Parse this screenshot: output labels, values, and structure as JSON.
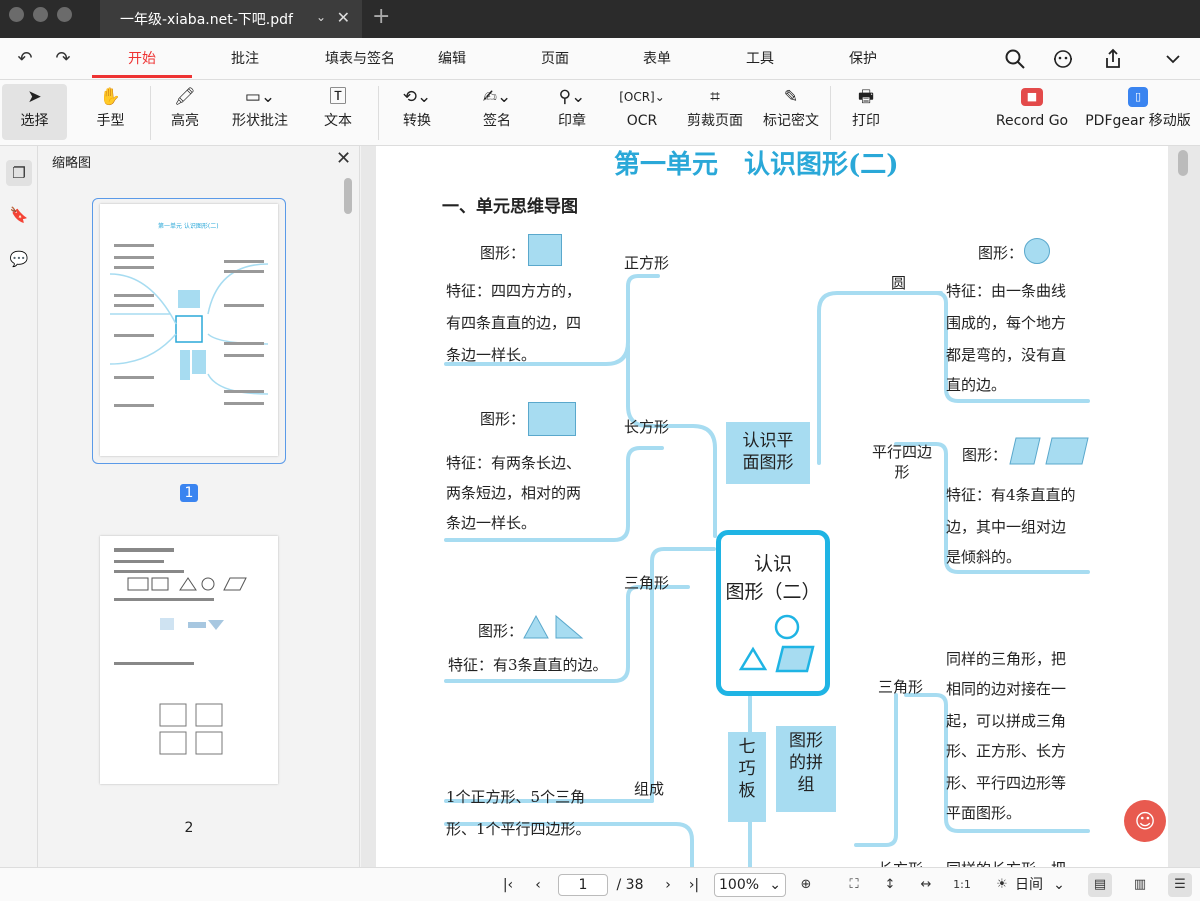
{
  "window": {
    "tab_title": "一年级-xiaba.net-下吧.pdf",
    "tab_menu_glyph": "⌄",
    "tab_close_glyph": "✕",
    "new_tab_glyph": "+"
  },
  "menubar": {
    "items": [
      "开始",
      "批注",
      "填表与签名",
      "编辑",
      "页面",
      "表单",
      "工具",
      "保护"
    ],
    "active": "开始"
  },
  "toolbar": {
    "tools": [
      {
        "label": "选择",
        "icon": "cursor-icon"
      },
      {
        "label": "手型",
        "icon": "hand-icon"
      },
      {
        "label": "高亮",
        "icon": "highlighter-icon"
      },
      {
        "label": "形状批注",
        "icon": "shape-icon"
      },
      {
        "label": "文本",
        "icon": "text-box-icon"
      },
      {
        "label": "转换",
        "icon": "convert-icon"
      },
      {
        "label": "签名",
        "icon": "signature-icon"
      },
      {
        "label": "印章",
        "icon": "stamp-icon"
      },
      {
        "label": "OCR",
        "icon": "ocr-icon"
      },
      {
        "label": "剪裁页面",
        "icon": "crop-icon"
      },
      {
        "label": "标记密文",
        "icon": "redact-icon"
      },
      {
        "label": "打印",
        "icon": "printer-icon"
      },
      {
        "label": "Record Go",
        "icon": "record-icon"
      },
      {
        "label": "PDFgear 移动版",
        "icon": "mobile-icon"
      }
    ],
    "selected": "选择"
  },
  "thumbnails": {
    "title": "缩略图",
    "pages": [
      "1",
      "2"
    ],
    "current": "1"
  },
  "document": {
    "title": "第一单元　认识图形(二)",
    "section": "一、单元思维导图",
    "center_label_1": "认识",
    "center_label_2": "图形（二）",
    "left": [
      {
        "name": "正方形",
        "shape_label": "图形：",
        "feature": [
          "特征：四四方方的，",
          "有四条直直的边，四",
          "条边一样长。"
        ]
      },
      {
        "name": "长方形",
        "shape_label": "图形：",
        "feature": [
          "特征：有两条长边、",
          "两条短边，相对的两",
          "条边一样长。"
        ]
      },
      {
        "name": "三角形",
        "shape_label": "图形：",
        "feature": [
          "特征：有3条直直的边。"
        ]
      },
      {
        "name": "组成",
        "feature": [
          "1个正方形、5个三角",
          "形、1个平行四边形。"
        ]
      }
    ],
    "right": [
      {
        "name": "圆",
        "shape_label": "图形：",
        "feature": [
          "特征：由一条曲线",
          "围成的，每个地方",
          "都是弯的，没有直",
          "直的边。"
        ]
      },
      {
        "name": "平行四边形",
        "shape_label": "图形：",
        "feature": [
          "特征：有4条直直的",
          "边，其中一组对边",
          "是倾斜的。"
        ]
      },
      {
        "name": "三角形",
        "feature": [
          "同样的三角形，把",
          "相同的边对接在一",
          "起，可以拼成三角",
          "形、正方形、长方",
          "形、平行四边形等",
          "平面图形。"
        ]
      },
      {
        "name": "长方形",
        "feature": [
          "同样的长方形，把"
        ]
      }
    ],
    "sub_boxes": {
      "plane": "认识平面图形",
      "plane_lines": [
        "认识平",
        "面图形"
      ],
      "tangram": [
        "七",
        "巧",
        "板"
      ],
      "combine": [
        "图形",
        "的拼",
        "组"
      ]
    }
  },
  "statusbar": {
    "current_page": "1",
    "total_pages": "/ 38",
    "zoom": "100%",
    "theme": "日间"
  },
  "colors": {
    "accent": "#e33333",
    "mindmap_line": "#a7dcf1",
    "mindmap_title": "#2aa8d8",
    "thumb_selected": "#3a84f0"
  }
}
